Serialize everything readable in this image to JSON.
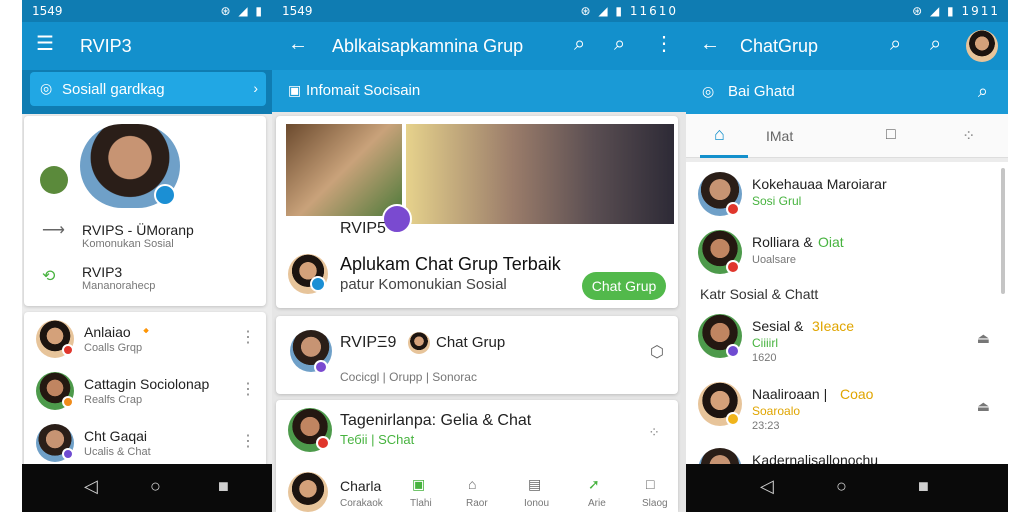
{
  "colors": {
    "primary": "#1390cc",
    "primary_dark": "#0f7cb2",
    "accent_green": "#47b33f",
    "nav_dark": "#0a0a0a"
  },
  "panel1": {
    "status": {
      "time": "1549",
      "icons": "⊛ ◢ ▮"
    },
    "appbar": {
      "title": "RVIP3",
      "menu_icon": "menu-icon"
    },
    "search_chip": {
      "label": "Sosiall gardkag"
    },
    "profile": {
      "items": [
        {
          "title": "RVIPS - ÜMoranp",
          "subtitle": "Komonukan Sosial"
        },
        {
          "title": "RVIP3",
          "subtitle": "Mananorahecp"
        }
      ]
    },
    "chats": [
      {
        "name": "Anlaiao",
        "emoji": "🔸",
        "subtitle": "Coalls Grqp"
      },
      {
        "name": "Cattagin Sociolonap",
        "subtitle": "Realfs Crap"
      },
      {
        "name": "Cht Gaqai",
        "subtitle": "Ucalis & Chat"
      }
    ]
  },
  "panel2": {
    "status": {
      "time": "1549",
      "icons": "⊛ ◢ ▮ 11610"
    },
    "appbar": {
      "title": "Ablkaisapkamnina Grup"
    },
    "subbar": {
      "label": "Infomait Socisain"
    },
    "group_card": {
      "group_name": "RVIP5",
      "title": "Aplukam Chat Grup Terbaik",
      "subtitle": "patur Komonukian Sosial",
      "button": "Chat Grup"
    },
    "row1": {
      "name": "RVIPΞ9",
      "chip": "Chat Grup",
      "meta": "Cocicgl  |  Orupp  |  Sonorac"
    },
    "row2": {
      "title": "Tagenirlanpa: Gelia & Chat",
      "tag": "Тебіі | SChat"
    },
    "bottom": {
      "name": "Charla",
      "subtitle": "Corakaok",
      "tabs": [
        "Tlahi",
        "Raor",
        "Ionou",
        "Arie",
        "Slaog"
      ]
    }
  },
  "panel3": {
    "status": {
      "icons": "⊛ ◢ ▮ 1911"
    },
    "appbar": {
      "title": "ChatGrup"
    },
    "subbar": {
      "label": "Bai Ghatd"
    },
    "tabs": {
      "second": "IMat"
    },
    "chats": [
      {
        "name": "Kokehauaa Maroiarar",
        "sub": "Sosi Grul"
      },
      {
        "name": "Rolliara & ",
        "name_green": "Oiat",
        "sub": "Uoalsare"
      }
    ],
    "section": "Katr Sosial & Chatt",
    "chats2": [
      {
        "name": "Sesial & ",
        "name_yellow": "3Iеасе",
        "sub": "Ciiiirl",
        "time": "1620"
      },
      {
        "name": "Naaliroaan |",
        "name_yellow": "Coao",
        "sub": "Soaroalo",
        "time": "23:23"
      },
      {
        "name": "Kadernalisallonochu"
      }
    ]
  }
}
